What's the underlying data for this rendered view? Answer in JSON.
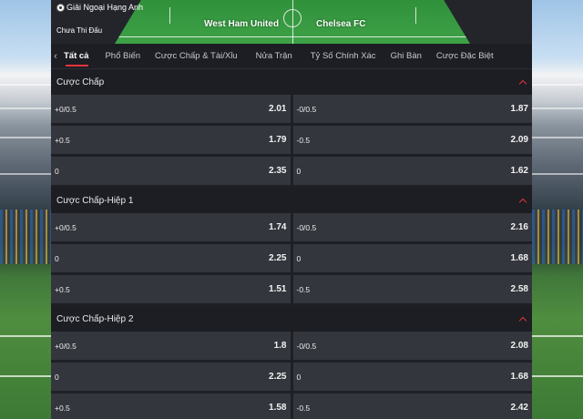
{
  "match": {
    "league": "Giải Ngoại Hạng Anh",
    "status": "Chưa Thi Đấu",
    "home_team": "West Ham United",
    "away_team": "Chelsea FC"
  },
  "tabs": [
    "Tất cả",
    "Phổ Biến",
    "Cược Chấp & Tài/Xỉu",
    "Nửa Trận",
    "Tỷ Số Chính Xác",
    "Ghi Bàn",
    "Cược Đặc Biệt"
  ],
  "active_tab": "Tất cả",
  "sections": [
    {
      "title": "Cược Chấp",
      "rows": [
        {
          "h_line": "+0/0.5",
          "h_odd": "2.01",
          "a_line": "-0/0.5",
          "a_odd": "1.87"
        },
        {
          "h_line": "+0.5",
          "h_odd": "1.79",
          "a_line": "-0.5",
          "a_odd": "2.09"
        },
        {
          "h_line": "0",
          "h_odd": "2.35",
          "a_line": "0",
          "a_odd": "1.62"
        }
      ]
    },
    {
      "title": "Cược Chấp-Hiệp 1",
      "rows": [
        {
          "h_line": "+0/0.5",
          "h_odd": "1.74",
          "a_line": "-0/0.5",
          "a_odd": "2.16"
        },
        {
          "h_line": "0",
          "h_odd": "2.25",
          "a_line": "0",
          "a_odd": "1.68"
        },
        {
          "h_line": "+0.5",
          "h_odd": "1.51",
          "a_line": "-0.5",
          "a_odd": "2.58"
        }
      ]
    },
    {
      "title": "Cược Chấp-Hiệp 2",
      "rows": [
        {
          "h_line": "+0/0.5",
          "h_odd": "1.8",
          "a_line": "-0/0.5",
          "a_odd": "2.08"
        },
        {
          "h_line": "0",
          "h_odd": "2.25",
          "a_line": "0",
          "a_odd": "1.68"
        },
        {
          "h_line": "+0.5",
          "h_odd": "1.58",
          "a_line": "-0.5",
          "a_odd": "2.42"
        }
      ]
    }
  ],
  "colors": {
    "accent": "#e8323c",
    "cell_bg": "#33363d",
    "page_bg": "#1e2026"
  }
}
